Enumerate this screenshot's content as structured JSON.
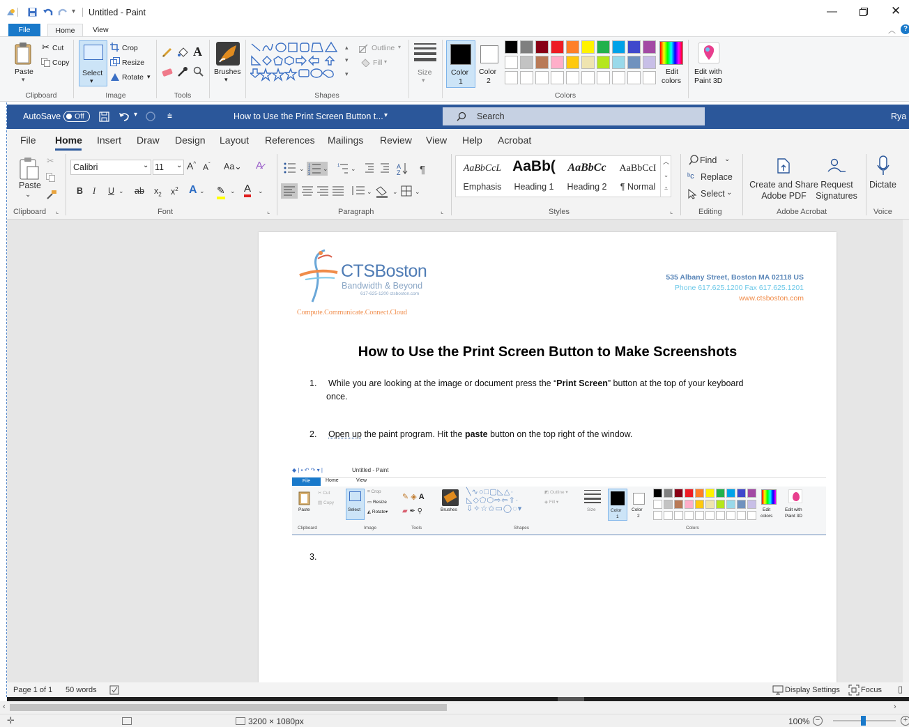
{
  "paint": {
    "window_title": "Untitled - Paint",
    "tabs": [
      "File",
      "Home",
      "View"
    ],
    "clipboard": {
      "paste": "Paste",
      "cut": "Cut",
      "copy": "Copy",
      "group": "Clipboard"
    },
    "image": {
      "select": "Select",
      "crop": "Crop",
      "resize": "Resize",
      "rotate": "Rotate",
      "group": "Image"
    },
    "tools": {
      "group": "Tools"
    },
    "brushes": "Brushes",
    "shapes": {
      "outline": "Outline",
      "fill": "Fill",
      "group": "Shapes"
    },
    "size": "Size",
    "color1": [
      "Color",
      "1"
    ],
    "color2": [
      "Color",
      "2"
    ],
    "edit_colors": [
      "Edit",
      "colors"
    ],
    "edit_paint3d": [
      "Edit with",
      "Paint 3D"
    ],
    "colors_group": "Colors",
    "palette_row1": [
      "#000000",
      "#7f7f7f",
      "#880015",
      "#ed1c24",
      "#ff7f27",
      "#fff200",
      "#22b14c",
      "#00a2e8",
      "#3f48cc",
      "#a349a4"
    ],
    "palette_row2": [
      "#ffffff",
      "#c3c3c3",
      "#b97a57",
      "#ffaec9",
      "#ffc90e",
      "#efe4b0",
      "#b5e61d",
      "#99d9ea",
      "#7092be",
      "#c8bfe7"
    ],
    "status_dimensions": "3200 × 1080px",
    "zoom": "100%"
  },
  "word": {
    "autosave": "AutoSave",
    "autosave_state": "Off",
    "doc_title": "How to Use the Print Screen Button t...",
    "search": "Search",
    "user_initials": "Rya",
    "menu": [
      "File",
      "Home",
      "Insert",
      "Draw",
      "Design",
      "Layout",
      "References",
      "Mailings",
      "Review",
      "View",
      "Help",
      "Acrobat"
    ],
    "clipboard": {
      "paste": "Paste",
      "group": "Clipboard"
    },
    "font": {
      "name": "Calibri",
      "size": "11",
      "group": "Font"
    },
    "paragraph_group": "Paragraph",
    "styles": [
      {
        "preview": "AaBbCcL",
        "name": "Emphasis"
      },
      {
        "preview": "AaBb(",
        "name": "Heading 1"
      },
      {
        "preview": "AaBbCc",
        "name": "Heading 2"
      },
      {
        "preview": "AaBbCcI",
        "name": "¶ Normal"
      }
    ],
    "styles_group": "Styles",
    "editing": {
      "find": "Find",
      "replace": "Replace",
      "select": "Select",
      "group": "Editing"
    },
    "acrobat": {
      "create": [
        "Create and Share",
        "Adobe PDF"
      ],
      "request": [
        "Request",
        "Signatures"
      ],
      "group": "Adobe Acrobat"
    },
    "voice": {
      "dictate": "Dictate",
      "group": "Voice"
    },
    "status": {
      "page": "Page 1 of 1",
      "words": "50 words",
      "display_settings": "Display Settings",
      "focus": "Focus"
    }
  },
  "document": {
    "logo_name": "CTSBoston",
    "logo_tagline": "Bandwidth & Beyond",
    "logo_phone": "617-625-1200 ctsboston.com",
    "slogan": "Compute.Communicate.Connect.Cloud",
    "address": "535 Albany Street, Boston MA 02118 US",
    "phone": "Phone 617.625.1200 Fax 617.625.1201",
    "website": "www.ctsboston.com",
    "heading": "How to Use the Print Screen Button to Make Screenshots",
    "step1_num": "1.",
    "step1_a": "While you are looking at the image or document press the “",
    "step1_b": "Print Screen",
    "step1_c": "” button at the top of your keyboard",
    "step1_d": "once.",
    "step2_num": "2.",
    "step2_a": "Open up",
    "step2_b": " the paint program.  Hit the ",
    "step2_c": "paste",
    "step2_d": " button on the top right of the window.",
    "step3_num": "3."
  }
}
